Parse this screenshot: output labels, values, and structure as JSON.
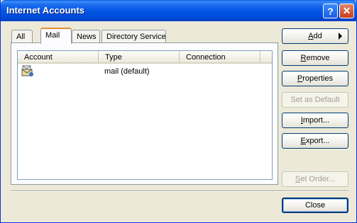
{
  "window": {
    "title": "Internet Accounts"
  },
  "titlebar_buttons": {
    "help": "?",
    "close": "✕"
  },
  "tabs": [
    {
      "label": "All"
    },
    {
      "label": "Mail",
      "active": true
    },
    {
      "label": "News"
    },
    {
      "label": "Directory Service"
    }
  ],
  "list": {
    "columns": [
      "Account",
      "Type",
      "Connection"
    ],
    "rows": [
      {
        "account": "",
        "type": "mail (default)",
        "connection": "",
        "icon": "mail-account-icon"
      }
    ]
  },
  "buttons": {
    "add": {
      "key": "A",
      "rest": "dd"
    },
    "remove": {
      "key": "R",
      "rest": "emove"
    },
    "properties": {
      "key": "P",
      "rest": "roperties"
    },
    "set_default": {
      "label": "Set as Default"
    },
    "import": {
      "key": "I",
      "rest": "mport..."
    },
    "export": {
      "key": "E",
      "rest": "xport..."
    },
    "set_order": {
      "key": "S",
      "rest": "et Order..."
    },
    "close": {
      "label": "Close"
    }
  },
  "colors": {
    "titlebar": "#0054E3",
    "dialog_bg": "#ECE9D8",
    "active_tab_accent": "#E68B2C",
    "button_border": "#003C74"
  }
}
